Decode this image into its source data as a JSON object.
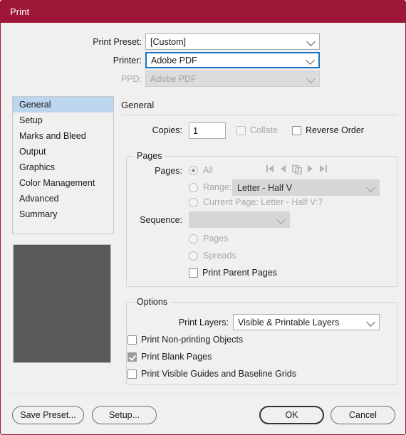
{
  "window": {
    "title": "Print",
    "accent_color": "#9e1638",
    "background_color": "#f0f0f0"
  },
  "top_fields": [
    {
      "label": "Print Preset:",
      "value": "[Custom]",
      "state": "enabled"
    },
    {
      "label": "Printer:",
      "value": "Adobe PDF",
      "state": "focused"
    },
    {
      "label": "PPD:",
      "value": "Adobe PDF",
      "state": "disabled"
    }
  ],
  "sidebar": {
    "items": [
      {
        "label": "General",
        "selected": true
      },
      {
        "label": "Setup",
        "selected": false
      },
      {
        "label": "Marks and Bleed",
        "selected": false
      },
      {
        "label": "Output",
        "selected": false
      },
      {
        "label": "Graphics",
        "selected": false
      },
      {
        "label": "Color Management",
        "selected": false
      },
      {
        "label": "Advanced",
        "selected": false
      },
      {
        "label": "Summary",
        "selected": false
      }
    ],
    "selection_color": "#bcd6ef"
  },
  "preview": {
    "color": "#595959"
  },
  "panel": {
    "title": "General",
    "copies": {
      "label": "Copies:",
      "value": "1",
      "collate_label": "Collate",
      "collate_checked": false,
      "collate_enabled": false,
      "reverse_order_label": "Reverse Order",
      "reverse_order_checked": false,
      "reverse_order_enabled": true
    },
    "pages_group": {
      "legend": "Pages",
      "pages_label": "Pages:",
      "all_label": "All",
      "all_selected": true,
      "range_label": "Range:",
      "range_value": "Letter - Half V",
      "range_selected": false,
      "current_page_label": "Current Page: Letter - Half V:7",
      "current_page_selected": false,
      "sequence_label": "Sequence:",
      "sequence_value": "",
      "pages_radio_label": "Pages",
      "pages_radio_selected": false,
      "spreads_radio_label": "Spreads",
      "spreads_radio_selected": false,
      "print_parent_pages_label": "Print Parent Pages",
      "print_parent_pages_checked": false,
      "nav_icons": [
        "first-page-icon",
        "previous-page-icon",
        "spread-pages-icon",
        "next-page-icon",
        "last-page-icon"
      ]
    },
    "options_group": {
      "legend": "Options",
      "print_layers_label": "Print Layers:",
      "print_layers_value": "Visible & Printable Layers",
      "checkboxes": [
        {
          "label": "Print Non-printing Objects",
          "checked": false
        },
        {
          "label": "Print Blank Pages",
          "checked": true
        },
        {
          "label": "Print Visible Guides and Baseline Grids",
          "checked": false
        }
      ]
    }
  },
  "footer": {
    "save_preset_label": "Save Preset...",
    "setup_label": "Setup...",
    "ok_label": "OK",
    "cancel_label": "Cancel"
  }
}
